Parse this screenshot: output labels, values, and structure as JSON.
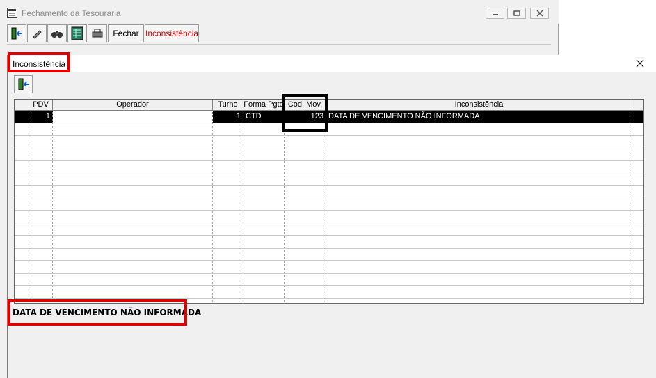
{
  "background_window": {
    "title": "Fechamento da Tesouraria",
    "toolbar": {
      "fechar_label": "Fechar",
      "inconsistencia_label": "Inconsistência"
    }
  },
  "dialog": {
    "title": "Inconsistência",
    "grid": {
      "columns": [
        "PDV",
        "Operador",
        "Turno",
        "Forma Pgto",
        "Cod. Mov.",
        "Inconsistência"
      ],
      "rows": [
        {
          "pdv": "1",
          "operador": "",
          "turno": "1",
          "forma_pgto": "CTD",
          "cod_mov": "123",
          "inconsistencia": "DATA DE VENCIMENTO NÃO INFORMADA"
        }
      ]
    },
    "message": "DATA DE VENCIMENTO NÃO INFORMADA"
  },
  "colors": {
    "highlight_red": "#e00000",
    "highlight_black": "#000000",
    "selected_row": "#000000"
  }
}
